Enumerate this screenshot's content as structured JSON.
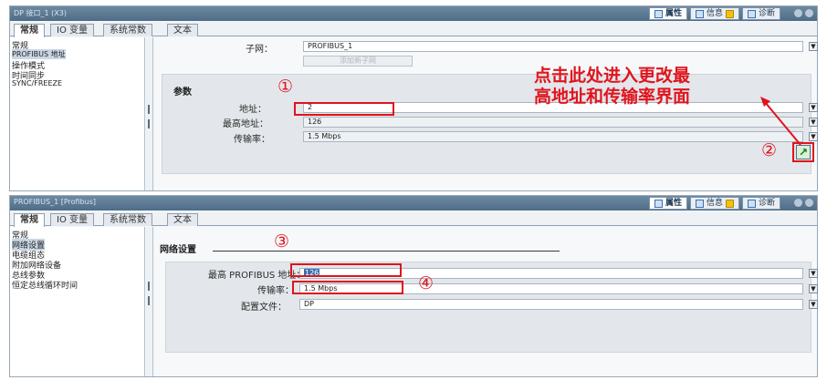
{
  "top_panel": {
    "title": "DP 接口_1 (X3)",
    "inspector_tabs": {
      "properties": "属性",
      "info": "信息",
      "diagnostics": "诊断"
    },
    "tabs": [
      "常规",
      "IO 变量",
      "系统常数",
      "文本"
    ],
    "nav": [
      "常规",
      "PROFIBUS 地址",
      "操作模式",
      "时间同步",
      "SYNC/FREEZE"
    ],
    "subnet_label": "子网：",
    "subnet_value": "PROFIBUS_1",
    "add_subnet_button": "添加新子网",
    "params_title": "参数",
    "address_label": "地址：",
    "address_value": "2",
    "highest_address_label": "最高地址：",
    "highest_address_value": "126",
    "baud_label": "传输率：",
    "baud_value": "1.5 Mbps"
  },
  "bottom_panel": {
    "title": "PROFIBUS_1 [Profibus]",
    "inspector_tabs": {
      "properties": "属性",
      "info": "信息",
      "diagnostics": "诊断"
    },
    "tabs": [
      "常规",
      "IO 变量",
      "系统常数",
      "文本"
    ],
    "nav": [
      "常规",
      "网络设置",
      "电缆组态",
      "附加网络设备",
      "总线参数",
      "恒定总线循环时间"
    ],
    "network_title": "网络设置",
    "highest_address_label": "最高 PROFIBUS 地址：",
    "highest_address_value": "126",
    "baud_label": "传输率：",
    "baud_value": "1.5 Mbps",
    "profile_label": "配置文件：",
    "profile_value": "DP"
  },
  "annotations": {
    "one": "①",
    "two": "②",
    "three": "③",
    "four": "④",
    "note_line1": "点击此处进入更改最",
    "note_line2": "高地址和传输率界面"
  },
  "colors": {
    "annotation_red": "#e0141c",
    "titlebar": "#5a7892"
  }
}
